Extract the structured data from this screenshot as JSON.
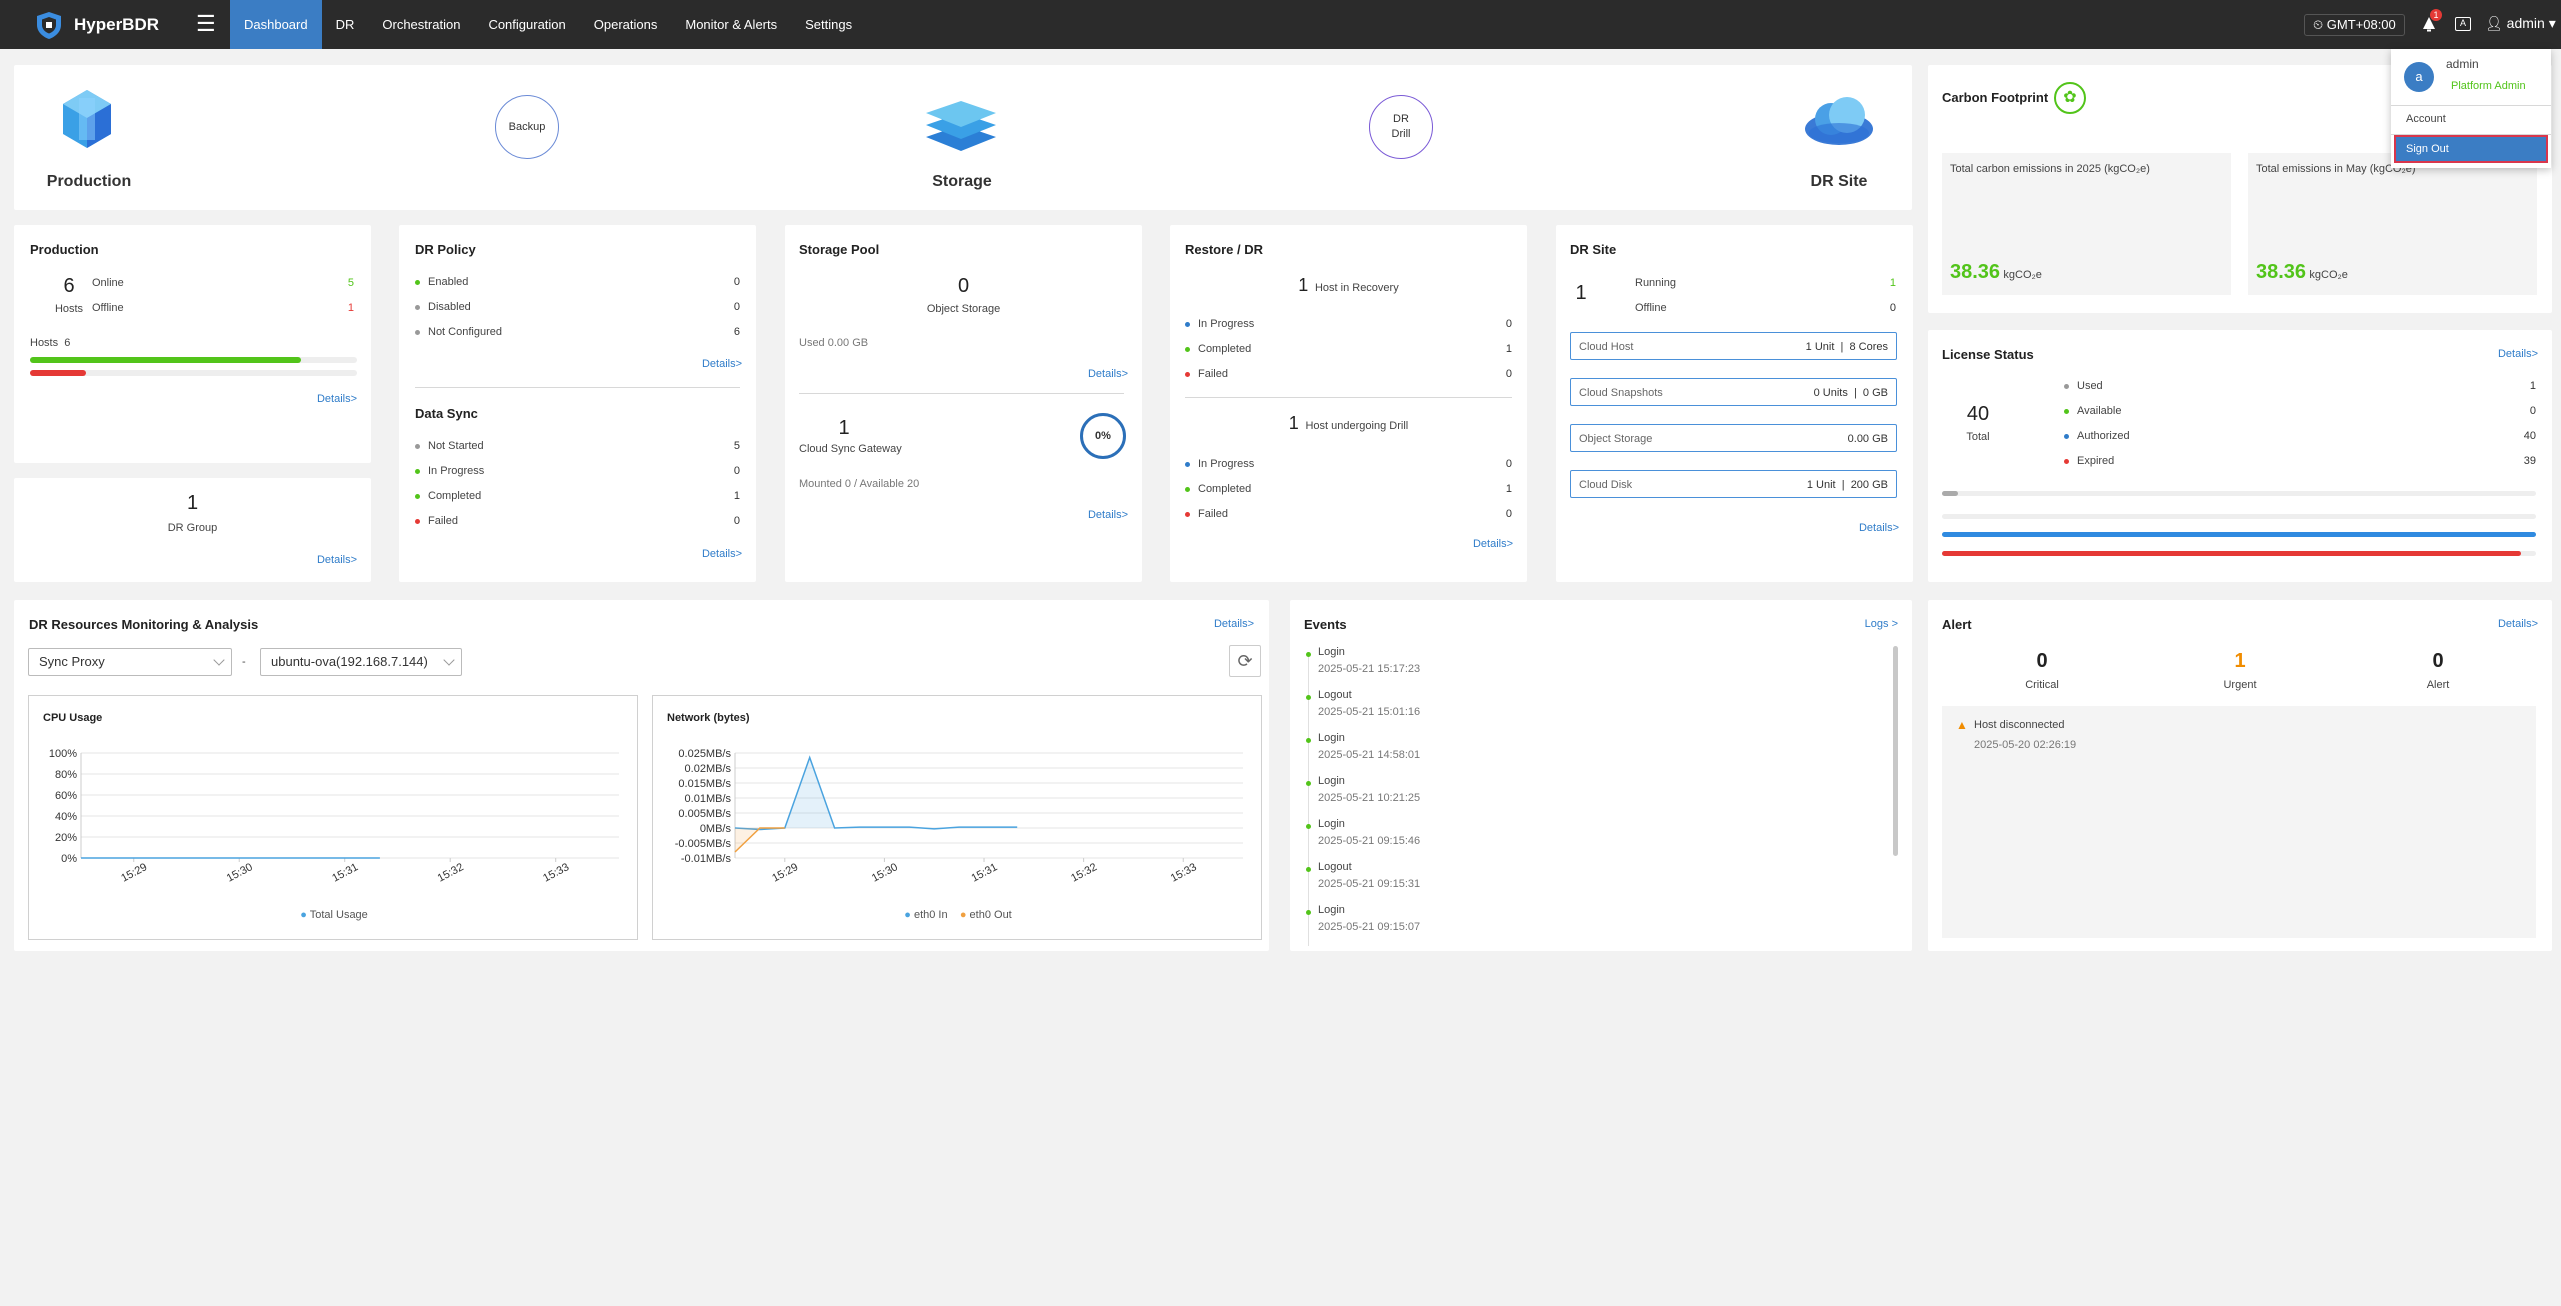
{
  "app": {
    "name": "HyperBDR"
  },
  "nav": {
    "items": [
      "Dashboard",
      "DR",
      "Orchestration",
      "Configuration",
      "Operations",
      "Monitor & Alerts",
      "Settings"
    ],
    "timezone": "GMT+08:00",
    "bell_count": "1",
    "lang_icon": "A",
    "user": "admin"
  },
  "user_menu": {
    "name": "admin",
    "avatar": "a",
    "role": "Platform Admin",
    "account": "Account",
    "signout": "Sign Out"
  },
  "flow": {
    "production": "Production",
    "backup": "Backup",
    "storage": "Storage",
    "drill_1": "DR",
    "drill_2": "Drill",
    "dr_site": "DR Site"
  },
  "production": {
    "title": "Production",
    "hosts_count": "6",
    "hosts_label": "Hosts",
    "online_label": "Online",
    "online": "5",
    "offline_label": "Offline",
    "offline": "1",
    "bar_label": "Hosts",
    "bar_count": "6",
    "online_fraction": 0.83,
    "offline_fraction": 0.17,
    "details": "Details>"
  },
  "dr_group": {
    "count": "1",
    "label": "DR Group",
    "details": "Details>"
  },
  "dr_policy": {
    "title": "DR Policy",
    "rows": [
      {
        "label": "Enabled",
        "value": "0",
        "color": "#52c41a"
      },
      {
        "label": "Disabled",
        "value": "0",
        "color": "#999999"
      },
      {
        "label": "Not Configured",
        "value": "6",
        "color": "#999999"
      }
    ],
    "details": "Details>"
  },
  "data_sync": {
    "title": "Data Sync",
    "rows": [
      {
        "label": "Not Started",
        "value": "5",
        "color": "#999999"
      },
      {
        "label": "In Progress",
        "value": "0",
        "color": "#52c41a"
      },
      {
        "label": "Completed",
        "value": "1",
        "color": "#52c41a"
      },
      {
        "label": "Failed",
        "value": "0",
        "color": "#e53935"
      }
    ],
    "details": "Details>"
  },
  "storage_pool": {
    "title": "Storage Pool",
    "obj_count": "0",
    "obj_label": "Object Storage",
    "used": "Used 0.00 GB",
    "details1": "Details>",
    "gw_count": "1",
    "gw_label": "Cloud Sync Gateway",
    "gw_percent": "0%",
    "mounted": "Mounted 0 / Available 20",
    "details2": "Details>"
  },
  "restore": {
    "title": "Restore / DR",
    "recovery_count": "1",
    "recovery_label": "Host in Recovery",
    "recovery_rows": [
      {
        "label": "In Progress",
        "value": "0",
        "color": "#2f7cc9"
      },
      {
        "label": "Completed",
        "value": "1",
        "color": "#52c41a"
      },
      {
        "label": "Failed",
        "value": "0",
        "color": "#e53935"
      }
    ],
    "drill_count": "1",
    "drill_label": "Host undergoing Drill",
    "drill_rows": [
      {
        "label": "In Progress",
        "value": "0",
        "color": "#2f7cc9"
      },
      {
        "label": "Completed",
        "value": "1",
        "color": "#52c41a"
      },
      {
        "label": "Failed",
        "value": "0",
        "color": "#e53935"
      }
    ],
    "details": "Details>"
  },
  "dr_site": {
    "title": "DR Site",
    "count": "1",
    "running_label": "Running",
    "running": "1",
    "offline_label": "Offline",
    "offline": "0",
    "boxes": [
      {
        "label": "Cloud Host",
        "value": "1 Unit  |  8 Cores"
      },
      {
        "label": "Cloud Snapshots",
        "value": "0 Units  |  0 GB"
      },
      {
        "label": "Object Storage",
        "value": "0.00 GB"
      },
      {
        "label": "Cloud Disk",
        "value": "1 Unit  |  200 GB"
      }
    ],
    "details": "Details>"
  },
  "carbon": {
    "title": "Carbon Footprint",
    "box1_label": "Total carbon emissions in 2025 (kgCO₂e)",
    "box1_value": "38.36",
    "box1_unit": "kgCO₂e",
    "box2_label": "Total emissions in May (kgCO₂e)",
    "box2_value": "38.36",
    "box2_unit": "kgCO₂e"
  },
  "license": {
    "title": "License Status",
    "details": "Details>",
    "total": "40",
    "total_label": "Total",
    "rows": [
      {
        "label": "Used",
        "value": "1",
        "color": "#999999"
      },
      {
        "label": "Available",
        "value": "0",
        "color": "#52c41a"
      },
      {
        "label": "Authorized",
        "value": "40",
        "color": "#2f7cc9"
      },
      {
        "label": "Expired",
        "value": "39",
        "color": "#e53935"
      }
    ],
    "used_fraction": 0.025,
    "authorized_fraction": 1.0,
    "expired_fraction": 0.975
  },
  "monitor": {
    "title": "DR Resources Monitoring & Analysis",
    "details": "Details>",
    "proxy": "Sync Proxy",
    "dash": "-",
    "host": "ubuntu-ova(192.168.7.144)"
  },
  "events": {
    "title": "Events",
    "logs": "Logs >",
    "items": [
      {
        "type": "Login",
        "time": "2025-05-21 15:17:23"
      },
      {
        "type": "Logout",
        "time": "2025-05-21 15:01:16"
      },
      {
        "type": "Login",
        "time": "2025-05-21 14:58:01"
      },
      {
        "type": "Login",
        "time": "2025-05-21 10:21:25"
      },
      {
        "type": "Login",
        "time": "2025-05-21 09:15:46"
      },
      {
        "type": "Logout",
        "time": "2025-05-21 09:15:31"
      },
      {
        "type": "Login",
        "time": "2025-05-21 09:15:07"
      }
    ]
  },
  "alert": {
    "title": "Alert",
    "details": "Details>",
    "critical": "0",
    "critical_label": "Critical",
    "urgent": "1",
    "urgent_label": "Urgent",
    "alert": "0",
    "alert_label": "Alert",
    "item_title": "Host disconnected",
    "item_time": "2025-05-20 02:26:19"
  },
  "chart_data": [
    {
      "type": "line",
      "title": "CPU Usage",
      "x": [
        "15:29",
        "15:30",
        "15:31",
        "15:32",
        "15:33"
      ],
      "yticks": [
        "100%",
        "80%",
        "60%",
        "40%",
        "20%",
        "0%"
      ],
      "ylim": [
        0,
        100
      ],
      "series": [
        {
          "name": "Total Usage",
          "color": "#4aa3df",
          "x_range": [
            "15:28:30",
            "15:31:20"
          ],
          "values": [
            0,
            0,
            0,
            0,
            0,
            0,
            0,
            0
          ]
        }
      ]
    },
    {
      "type": "line",
      "title": "Network (bytes)",
      "x": [
        "15:29",
        "15:30",
        "15:31",
        "15:32",
        "15:33"
      ],
      "yticks": [
        "0.025MB/s",
        "0.02MB/s",
        "0.015MB/s",
        "0.01MB/s",
        "0.005MB/s",
        "0MB/s",
        "-0.005MB/s",
        "-0.01MB/s"
      ],
      "ylim": [
        -0.01,
        0.025
      ],
      "series": [
        {
          "name": "eth0 In",
          "color": "#4aa3df",
          "times": [
            "15:28:30",
            "15:28:45",
            "15:29:00",
            "15:29:15",
            "15:29:30",
            "15:29:45",
            "15:30:00",
            "15:30:15",
            "15:30:30",
            "15:30:45",
            "15:31:00",
            "15:31:15",
            "15:31:20"
          ],
          "values": [
            0.0,
            -0.0005,
            0.0,
            0.0235,
            0.0,
            0.0003,
            0.0003,
            0.0003,
            -0.0003,
            0.0003,
            0.0003,
            0.0003,
            0.0003
          ]
        },
        {
          "name": "eth0 Out",
          "color": "#f0a040",
          "times": [
            "15:28:30",
            "15:28:45",
            "15:29:00"
          ],
          "values": [
            -0.008,
            0.0,
            0.0
          ]
        }
      ]
    }
  ]
}
